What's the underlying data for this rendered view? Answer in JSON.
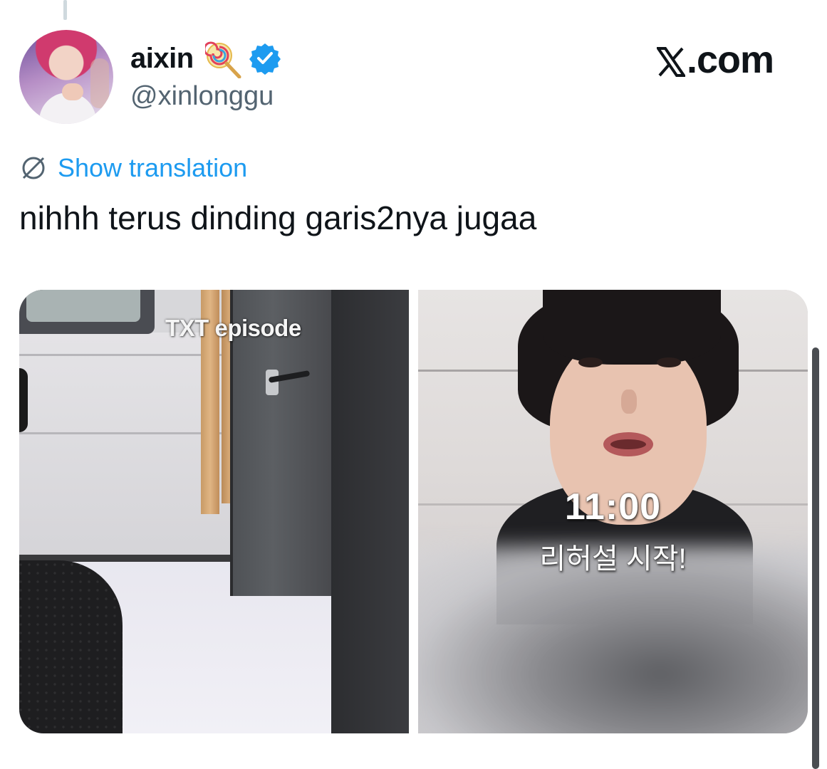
{
  "tweet": {
    "display_name": "aixin",
    "handle": "@xinlonggu",
    "show_translation": "Show translation",
    "text": "nihhh terus dinding garis2nya jugaa"
  },
  "watermark": {
    "site": ".com"
  },
  "media": {
    "left_image": {
      "overlay_text": "TXT episode"
    },
    "right_image": {
      "time_text": "11:00",
      "caption": "리허설 시작!"
    }
  },
  "icons": {
    "lollipop": "lollipop-emoji-icon",
    "verified": "verified-badge-icon",
    "translate": "globe-translate-icon",
    "x_logo": "x-logo-icon"
  },
  "colors": {
    "link": "#1d9bf0",
    "verified": "#1d9bf0",
    "secondary_text": "#536471"
  }
}
